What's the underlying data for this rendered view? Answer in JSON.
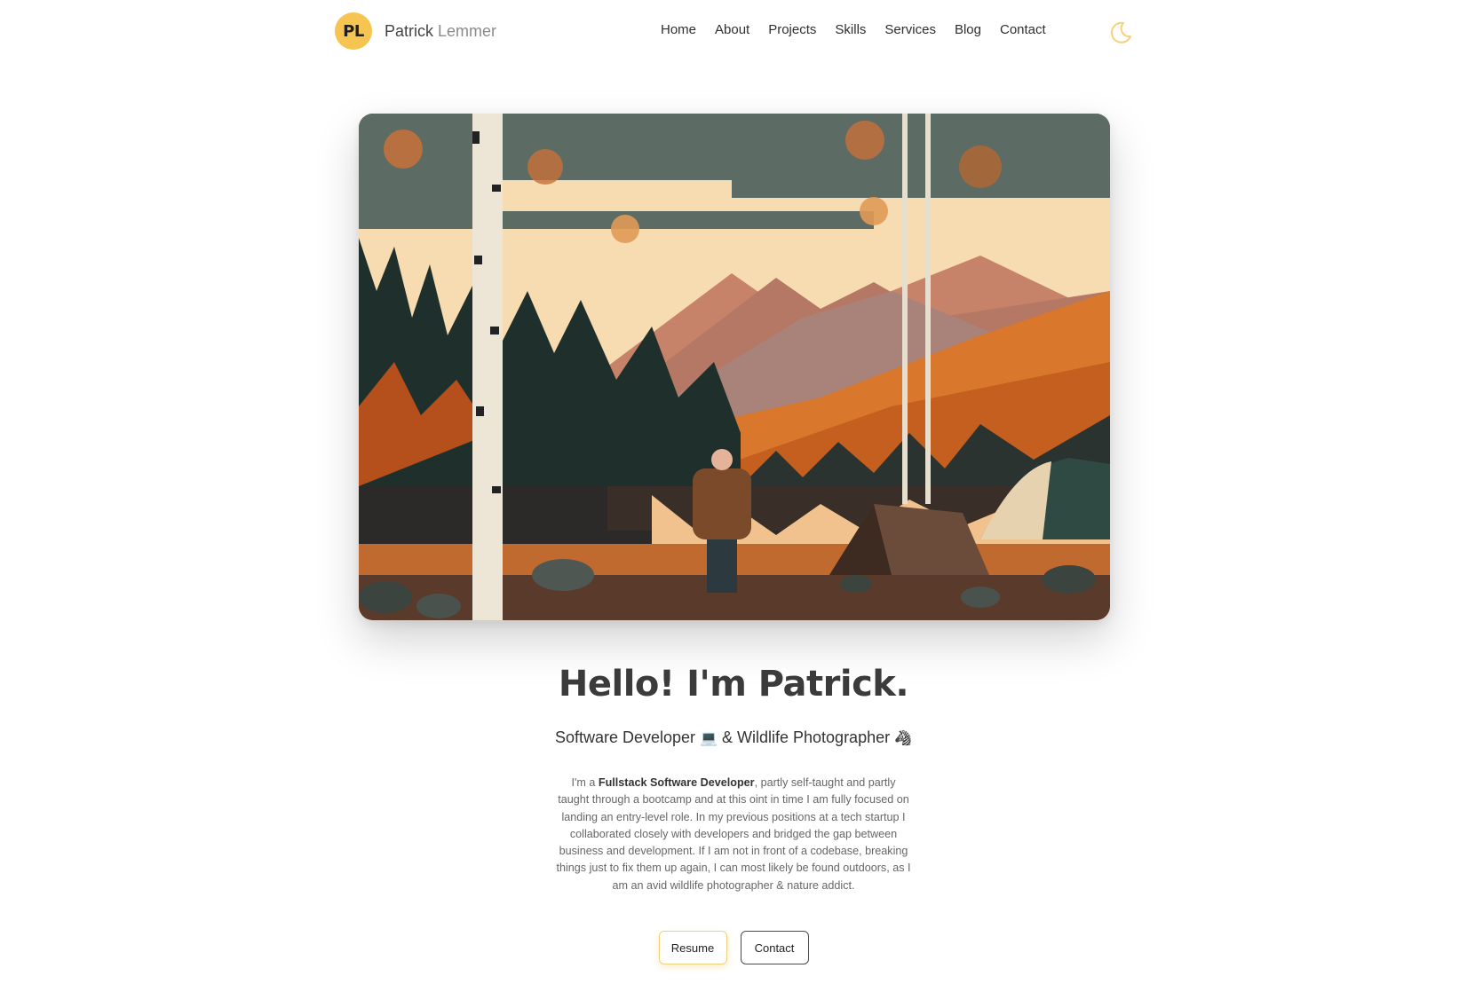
{
  "brand": {
    "initials": "PL",
    "first_name": "Patrick",
    "last_name": "Lemmer",
    "logo_color": "#f5c451"
  },
  "nav": {
    "items": [
      "Home",
      "About",
      "Projects",
      "Skills",
      "Services",
      "Blog",
      "Contact"
    ]
  },
  "theme_toggle": {
    "icon": "moon-icon",
    "color": "#f5d27a"
  },
  "hero": {
    "image": "illustration-hiker-lake-mountains-autumn"
  },
  "intro": {
    "title": "Hello! I'm Patrick.",
    "subtitle_part1": "Software Developer",
    "subtitle_emoji1": "💻",
    "subtitle_part2": "& Wildlife Photographer",
    "subtitle_emoji2": "🦓",
    "bio_prefix": "I'm a ",
    "bio_bold": "Fullstack Software Developer",
    "bio_rest": ", partly self-taught and partly taught through a bootcamp and at this oint in time I am fully focused on landing an entry-level role. In my previous positions at a tech startup I collaborated closely with developers and bridged the gap between business and development. If I am not in front of a codebase, breaking things just to fix them up again, I can most likely be found outdoors, as I am an avid wildlife photographer & nature addict."
  },
  "actions": {
    "resume_label": "Resume",
    "contact_label": "Contact",
    "resume_border": "#f0d27a"
  }
}
